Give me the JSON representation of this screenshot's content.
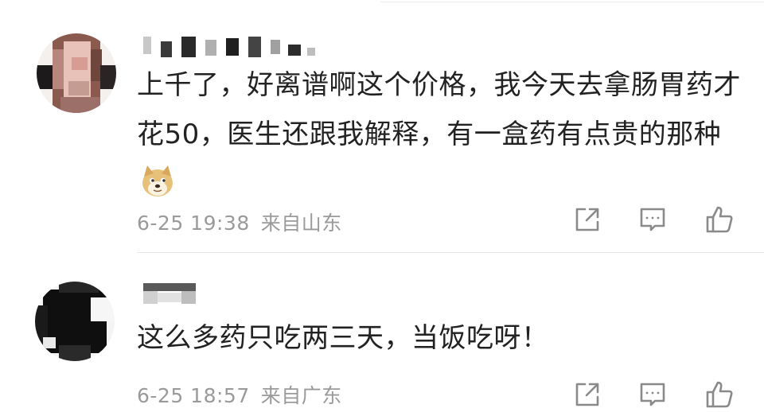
{
  "comments": [
    {
      "text": "上千了，好离谱啊这个价格，我今天去拿肠胃药才花50，医生还跟我解释，有一盒药有点贵的那种",
      "emoji": "doge-emoji",
      "time": "6-25 19:38",
      "location": "来自山东"
    },
    {
      "text": "这么多药只吃两三天，当饭吃呀！",
      "time": "6-25 18:57",
      "location": "来自广东"
    }
  ],
  "icons": {
    "share": "share-icon",
    "reply": "comment-icon",
    "like": "thumbs-up-icon"
  },
  "colors": {
    "text": "#222222",
    "meta": "#9a9a9a",
    "icon": "#8a8a8a",
    "divider": "#e6e6e6"
  }
}
